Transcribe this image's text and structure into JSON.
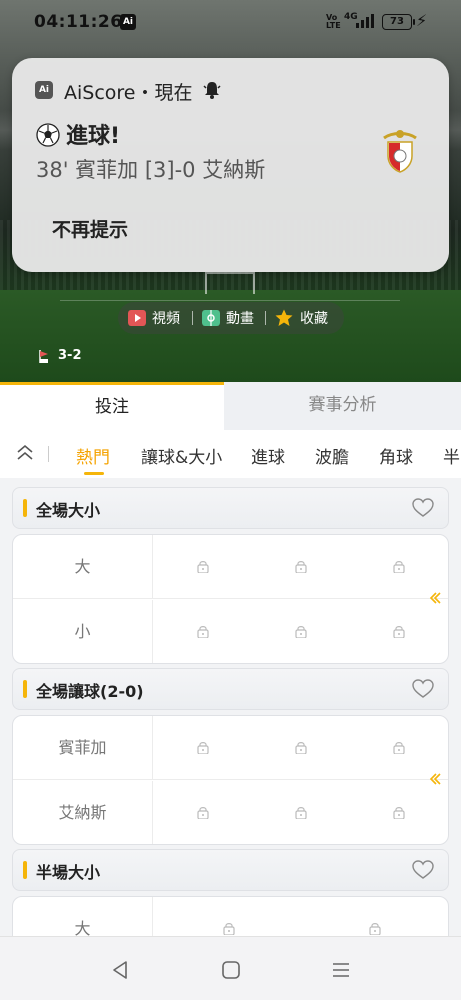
{
  "status_bar": {
    "time": "04:11:26",
    "battery": "73",
    "network": "4G",
    "volte": "Vo LTE"
  },
  "notification": {
    "app_name": "AiScore・現在",
    "app_icon_text": "Ai",
    "title": "進球!",
    "body": "38' 賓菲加 [3]-0 艾納斯",
    "dismiss_label": "不再提示",
    "icons": [
      "football-icon",
      "bell-icon",
      "club-crest-icon"
    ]
  },
  "match_actions": {
    "video_label": "視頻",
    "animation_label": "動畫",
    "favorite_label": "收藏",
    "corner_score": "3-2"
  },
  "tabs": {
    "bet_label": "投注",
    "analysis_label": "賽事分析"
  },
  "categories": [
    "熱門",
    "讓球&大小",
    "進球",
    "波膽",
    "角球",
    "半"
  ],
  "active_category": "熱門",
  "markets": [
    {
      "title": "全場大小",
      "rows": [
        "大",
        "小"
      ]
    },
    {
      "title": "全場讓球(2-0)",
      "rows": [
        "賓菲加",
        "艾納斯"
      ]
    },
    {
      "title": "半場大小",
      "rows": [
        "大"
      ]
    }
  ],
  "colors": {
    "accent": "#f5b50a",
    "active_text": "#f5a300",
    "tab_inactive_bg": "#eef0f3",
    "card_border": "#dfe1e5"
  }
}
